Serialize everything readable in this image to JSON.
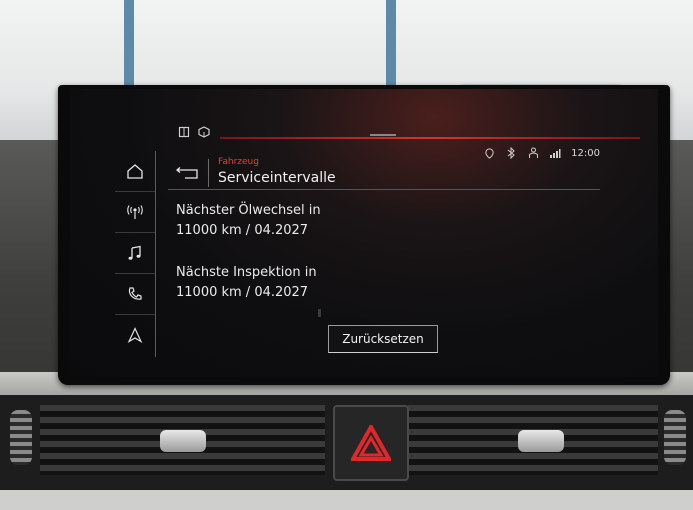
{
  "screen": {
    "status_bar": {
      "clock": "12:00",
      "icons": [
        "location-pin-icon",
        "bluetooth-icon",
        "person-icon",
        "signal-icon"
      ]
    },
    "top_left_icons": [
      "door-icon",
      "cube-icon"
    ],
    "sidebar": {
      "items": [
        {
          "icon": "home-icon",
          "glyph": "⌂"
        },
        {
          "icon": "radio-icon",
          "glyph": "((·))"
        },
        {
          "icon": "music-icon",
          "glyph": "♫"
        },
        {
          "icon": "phone-icon",
          "glyph": "✆"
        },
        {
          "icon": "navigation-icon",
          "glyph": "△"
        }
      ]
    },
    "header": {
      "breadcrumb": "Fahrzeug",
      "title": "Serviceintervalle"
    },
    "content": {
      "oil_change": {
        "label": "Nächster Ölwechsel in",
        "value": "11000 km / 04.2027"
      },
      "inspection": {
        "label": "Nächste Inspektion in",
        "value": "11000 km / 04.2027"
      },
      "reset_button": "Zurücksetzen"
    }
  },
  "colors": {
    "accent": "#e0412f",
    "text": "#ececec",
    "background": "#0e0e10",
    "hazard": "#e3262a"
  }
}
